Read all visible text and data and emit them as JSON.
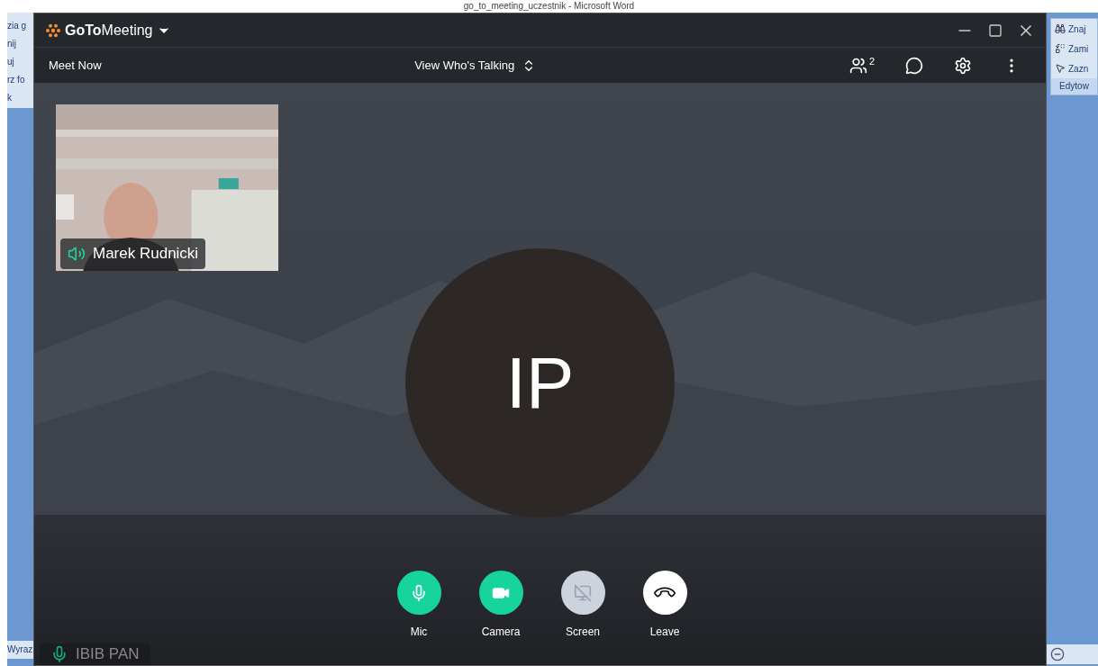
{
  "word_background": {
    "title": "go_to_meeting_uczestnik - Microsoft Word",
    "left_items": [
      "zia g",
      "nij",
      "uj",
      "rz fo",
      "k"
    ],
    "left_status": "Wyraz",
    "right_items": [
      {
        "kind": "find",
        "label": "Znaj"
      },
      {
        "kind": "replace",
        "label": "Zami"
      },
      {
        "kind": "select",
        "label": "Zazn"
      }
    ],
    "right_group": "Edytow"
  },
  "window": {
    "app_name_bold": "GoTo",
    "app_name": "Meeting"
  },
  "toolbar": {
    "meet_now": "Meet Now",
    "view_mode": "View Who's Talking",
    "participants_count": "2"
  },
  "self_view": {
    "kind": "picture",
    "name": "Marek Rudnicki",
    "speaking": true
  },
  "speaker": {
    "initials": "IP"
  },
  "controls": [
    {
      "kind": "mic",
      "label": "Mic",
      "on": true
    },
    {
      "kind": "camera",
      "label": "Camera",
      "on": true
    },
    {
      "kind": "screen",
      "label": "Screen",
      "on": false
    },
    {
      "kind": "leave",
      "label": "Leave"
    }
  ],
  "participant_tile": {
    "name": "IBIB PAN",
    "mic_on": true
  }
}
